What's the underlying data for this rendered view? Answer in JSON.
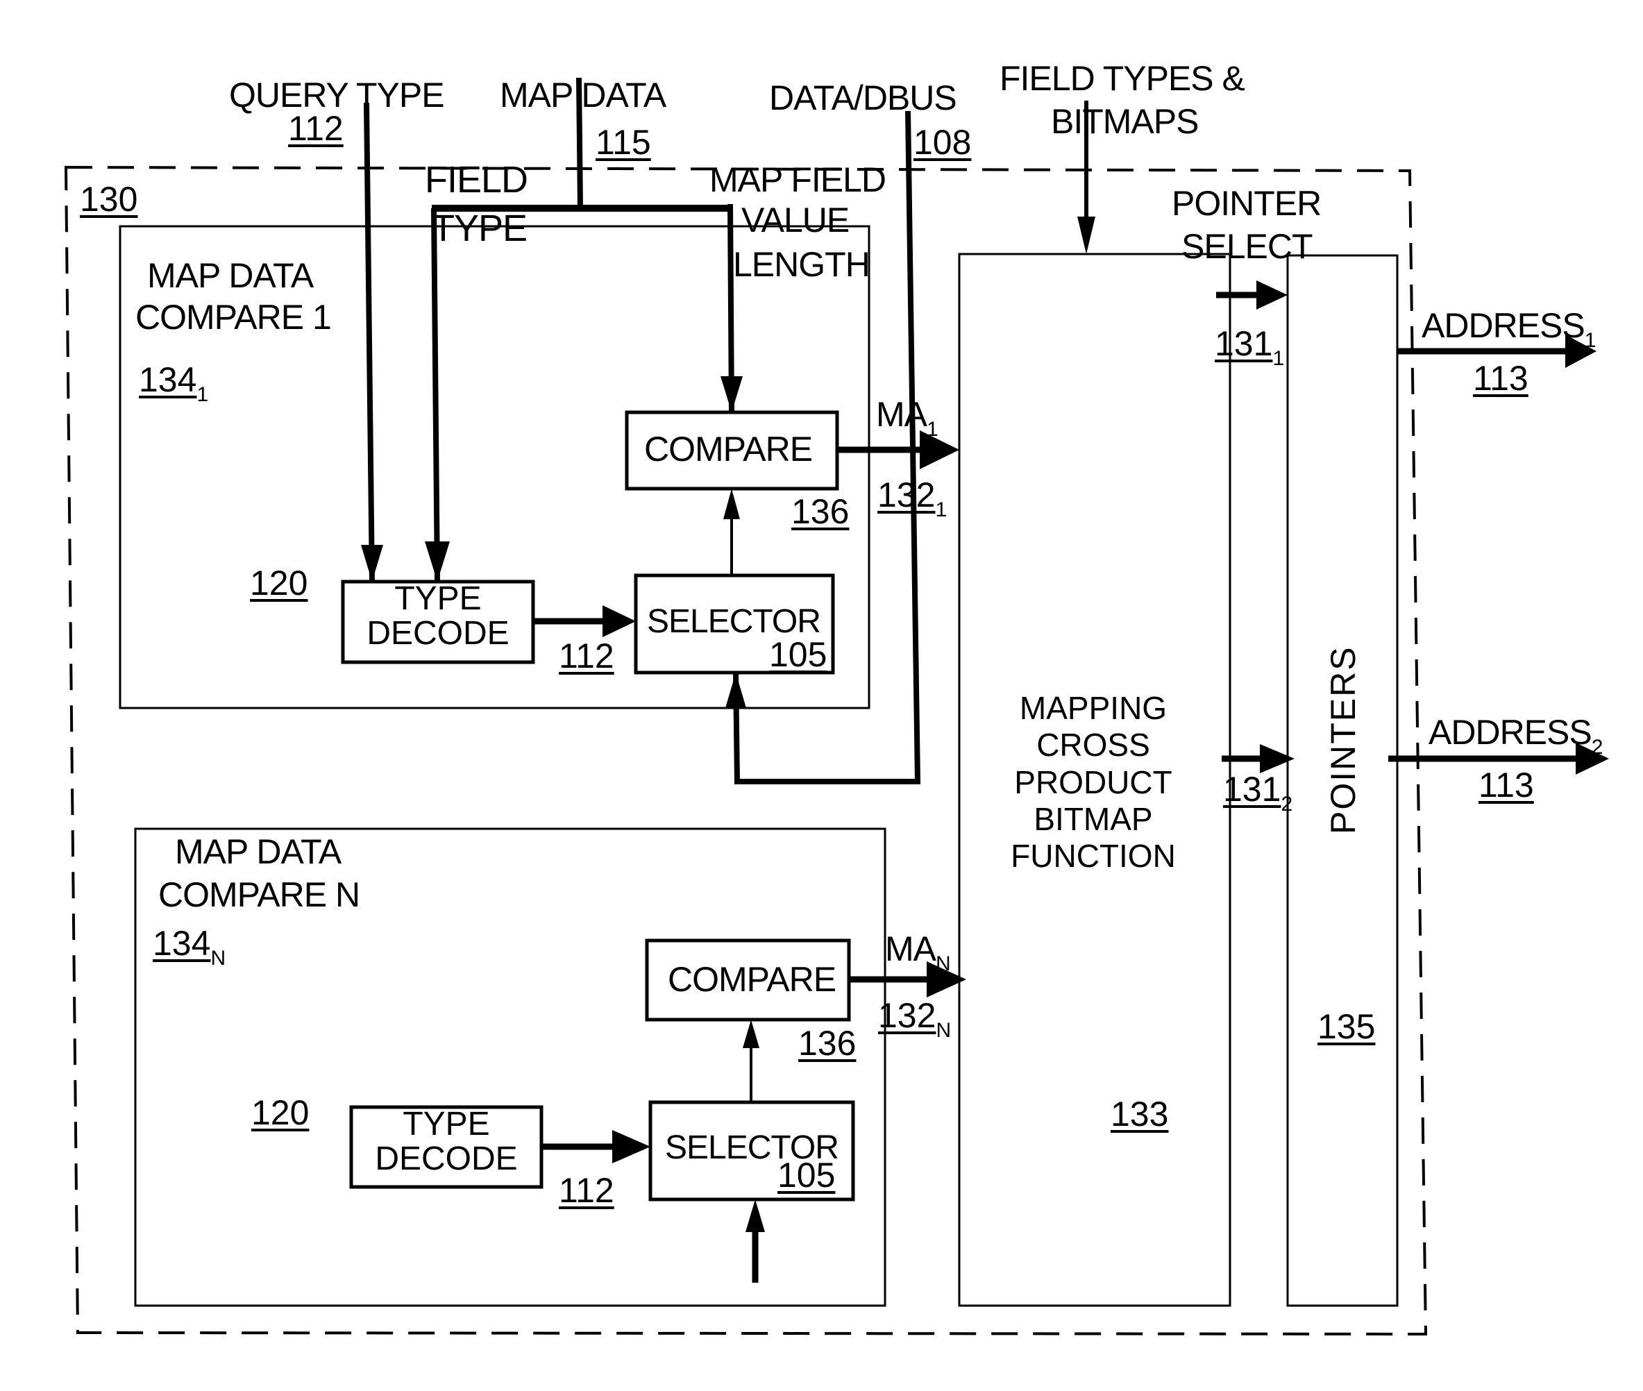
{
  "figure": {
    "inputs": {
      "query_type": {
        "label": "QUERY TYPE",
        "ref": "112"
      },
      "map_data": {
        "label": "MAP DATA",
        "ref": "115"
      },
      "data_dbus": {
        "label": "DATA/DBUS",
        "ref": "108"
      },
      "field_types_bitmaps": {
        "label_line1": "FIELD TYPES &",
        "label_line2": "BITMAPS"
      }
    },
    "outer_block": {
      "ref": "130"
    },
    "bus_labels": {
      "field_type_line1": "FIELD",
      "field_type_line2": "TYPE",
      "map_field_line1": "MAP FIELD",
      "map_field_line2": "VALUE",
      "map_field_line3": "LENGTH",
      "pointer_select_line1": "POINTER",
      "pointer_select_line2": "SELECT"
    },
    "compare_1": {
      "title_line1": "MAP DATA",
      "title_line2": "COMPARE 1",
      "ref": "134",
      "ref_sub": "1",
      "decoder_ref": "120",
      "type_decode_line1": "TYPE",
      "type_decode_line2": "DECODE",
      "type_decode_out_ref": "112",
      "selector_label": "SELECTOR",
      "selector_ref": "105",
      "compare_label": "COMPARE",
      "compare_ref": "136",
      "output_label": "MA",
      "output_sub": "1",
      "output_ref": "132",
      "output_ref_sub": "1"
    },
    "compare_n": {
      "title_line1": "MAP DATA",
      "title_line2": "COMPARE N",
      "ref": "134",
      "ref_sub": "N",
      "decoder_ref": "120",
      "type_decode_line1": "TYPE",
      "type_decode_line2": "DECODE",
      "type_decode_out_ref": "112",
      "selector_label": "SELECTOR",
      "selector_ref": "105",
      "compare_label": "COMPARE",
      "compare_ref": "136",
      "output_label": "MA",
      "output_sub": "N",
      "output_ref": "132",
      "output_ref_sub": "N"
    },
    "mapping_block": {
      "line1": "MAPPING",
      "line2": "CROSS",
      "line3": "PRODUCT",
      "line4": "BITMAP",
      "line5": "FUNCTION",
      "ref": "133"
    },
    "pointer_select_signals": [
      {
        "ref": "131",
        "sub": "1"
      },
      {
        "ref": "131",
        "sub": "2"
      }
    ],
    "pointers_block": {
      "label": "POINTERS",
      "ref": "135"
    },
    "outputs": [
      {
        "label": "ADDRESS",
        "sub": "1",
        "ref": "113"
      },
      {
        "label": "ADDRESS",
        "sub": "2",
        "ref": "113"
      }
    ]
  }
}
